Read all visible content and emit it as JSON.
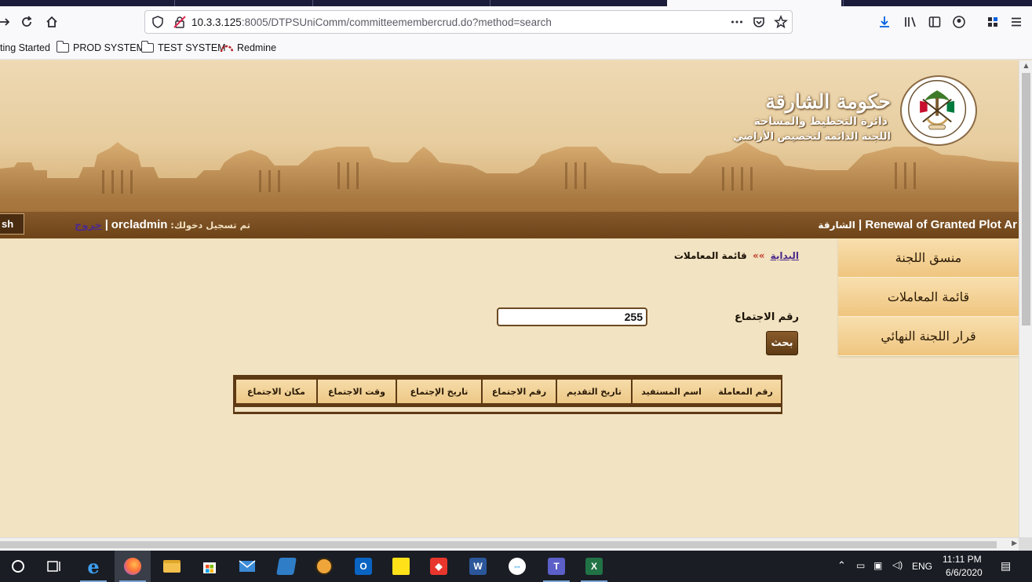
{
  "browser": {
    "url_host": "10.3.3.125",
    "url_rest": ":8005/DTPSUniComm/committeemembercrud.do?method=search",
    "bookmarks": [
      "ting Started",
      "PROD SYSTEM",
      "TEST SYSTEM",
      "Redmine"
    ]
  },
  "header": {
    "gov_title": "حكومة الشارقة",
    "dept_title": "دائرة التخطيط والمساحة",
    "committee_title": "اللجنة الدائمة لتخصيص الأراضي",
    "lang_button": "sh",
    "logout_label": "خروج",
    "username": "orcladmin",
    "logged_in_label": "تم تسجيل دخولك:",
    "app_name": "Renewal of Granted Plot Ar",
    "city": "الشارقة"
  },
  "sidebar": {
    "items": [
      {
        "label": "منسق اللجنة"
      },
      {
        "label": "قائمة المعاملات"
      },
      {
        "label": "قرار اللجنة النهائي"
      }
    ]
  },
  "breadcrumb": {
    "home": "البداية",
    "separator": "»»",
    "current": "قائمة المعاملات"
  },
  "search": {
    "meeting_number_label": "رقم الاجتماع",
    "meeting_number_value": "255",
    "search_button": "بحث"
  },
  "table": {
    "columns": [
      "رقم المعاملة",
      "اسم المستفيد",
      "تاريخ التقديم",
      "رقم الاجتماع",
      "تاريخ الإجتماع",
      "وقت الاجتماع",
      "مكان الاجتماع"
    ]
  },
  "taskbar": {
    "language": "ENG",
    "time": "11:11 PM",
    "date": "6/6/2020"
  },
  "colors": {
    "header_bar": "#7a4e1e",
    "menu_gold": "#efc57f",
    "link_purple": "#4d2a8b",
    "page_bg": "#f2e3c2"
  }
}
